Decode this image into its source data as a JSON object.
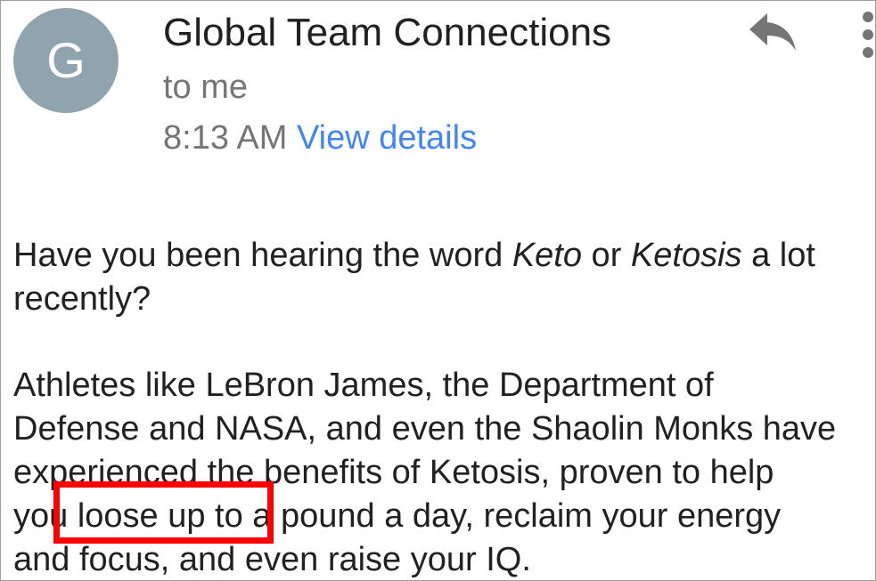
{
  "email": {
    "avatar_letter": "G",
    "sender": "Global Team Connections",
    "recipient": "to me",
    "time": "8:13 AM",
    "view_details": "View details"
  },
  "body": {
    "p1": {
      "t1": "Have you been hearing the word ",
      "em1": "Keto",
      "t2": " or ",
      "em2": "Ketosis",
      "t3": " a lot",
      "t4": "recently?"
    },
    "p2": {
      "l1": "Athletes like LeBron James, the Department of",
      "l2": "Defense and NASA, and even the Shaolin Monks have",
      "l3": "experienced the benefits of Ketosis, proven to help",
      "l4": "you loose up to a pound a day, reclaim your energy",
      "l5": "and focus, and even raise your IQ."
    }
  },
  "colors": {
    "avatar_bg": "#90a4ae",
    "link": "#4285f4",
    "highlight": "#ff0000"
  },
  "icons": {
    "reply": "reply-icon",
    "more": "more-vert-icon"
  }
}
